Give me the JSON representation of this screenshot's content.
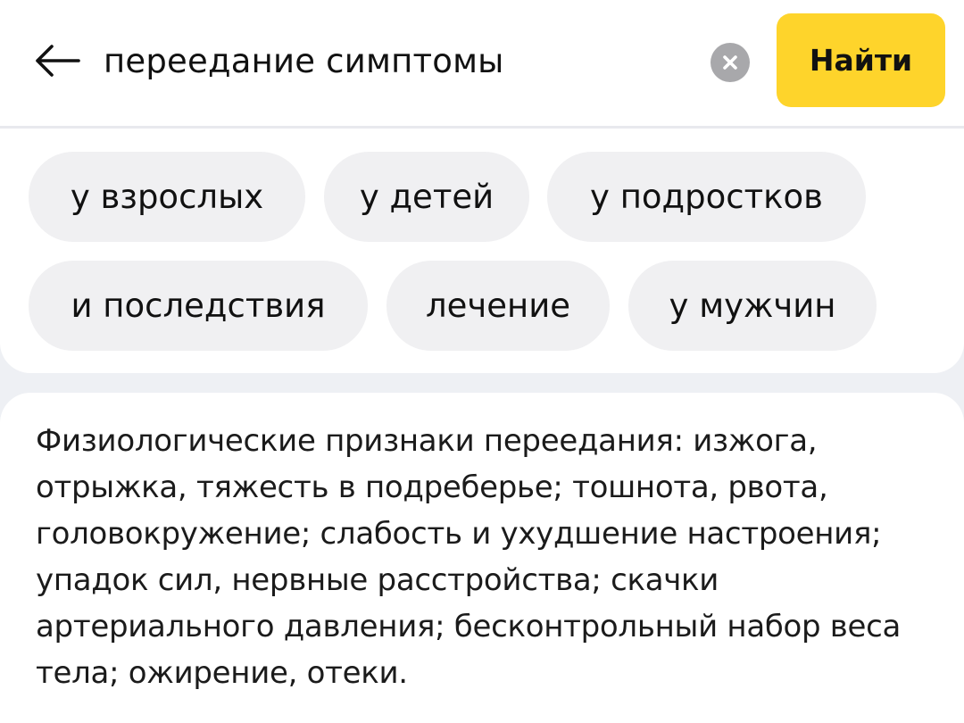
{
  "search": {
    "query": "переедание симптомы",
    "submit_label": "Найти",
    "back_icon": "arrow-left-icon",
    "clear_icon": "clear-circle-icon"
  },
  "suggestions": [
    {
      "label": "у взрослых"
    },
    {
      "label": "у детей"
    },
    {
      "label": "у подростков"
    },
    {
      "label": "и последствия"
    },
    {
      "label": "лечение"
    },
    {
      "label": "у мужчин"
    }
  ],
  "answer": {
    "text": "Физиологические признаки переедания: изжога, отрыжка, тяжесть в подреберье; тошнота, рвота, головокружение; слабость и ухудшение настроения; упадок сил, нервные расстройства; скачки артериального давления; бесконтрольный набор веса тела; ожирение, отеки."
  },
  "colors": {
    "accent": "#fed42b",
    "chip_background": "#f0f0f2",
    "page_background": "#eef0f4"
  }
}
